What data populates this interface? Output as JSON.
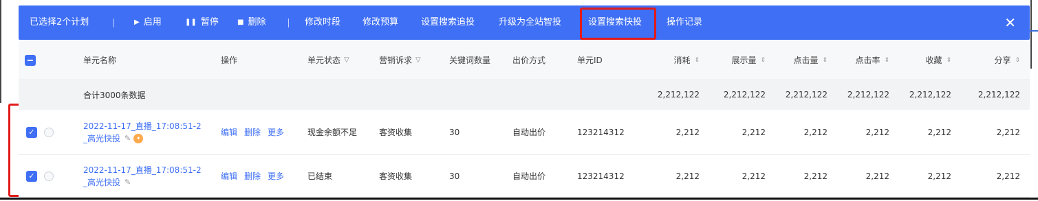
{
  "toolbar": {
    "selected_text": "已选择2个计划",
    "enable_label": "启用",
    "pause_label": "暂停",
    "delete_label": "删除",
    "modify_period": "修改时段",
    "modify_budget": "修改预算",
    "set_search_boost": "设置搜索追投",
    "upgrade_smart": "升级为全站智投",
    "set_search_quick": "设置搜索快投",
    "operation_log": "操作记录",
    "close_glyph": "✕",
    "enable_icon": "play-icon",
    "pause_icon": "pause-icon",
    "delete_icon": "trash-icon"
  },
  "table": {
    "headers": {
      "unit_name": "单元名称",
      "operation": "操作",
      "unit_status": "单元状态",
      "marketing_goal": "营销诉求",
      "keyword_count": "关键词数量",
      "bid_method": "出价方式",
      "unit_id": "单元ID",
      "cost": "消耗",
      "impressions": "展示量",
      "clicks": "点击量",
      "ctr": "点击率",
      "favorites": "收藏",
      "shares": "分享"
    },
    "total": {
      "label": "合计3000条数据",
      "cost": "2,212,122",
      "impressions": "2,212,122",
      "clicks": "2,212,122",
      "ctr": "2,212,122",
      "favorites": "2,212,122",
      "shares": "2,212,122"
    },
    "rows": [
      {
        "name_line1": "2022-11-17_直播_17:08:51-2",
        "name_line2": "_高光快投",
        "op_edit": "编辑",
        "op_delete": "删除",
        "op_more": "更多",
        "status": "现金余额不足",
        "goal": "客资收集",
        "keywords": "30",
        "bid": "自动出价",
        "unit_id": "123214312",
        "cost": "2,212",
        "impressions": "2,212",
        "clicks": "2,212",
        "ctr": "2,212",
        "favorites": "2,212",
        "shares": "2,212"
      },
      {
        "name_line1": "2022-11-17_直播_17:08:51-2",
        "name_line2": "_高光快投",
        "op_edit": "编辑",
        "op_delete": "删除",
        "op_more": "更多",
        "status": "已结束",
        "goal": "客资收集",
        "keywords": "30",
        "bid": "自动出价",
        "unit_id": "123214312",
        "cost": "2,212",
        "impressions": "2,212",
        "clicks": "2,212",
        "ctr": "2,212",
        "favorites": "2,212",
        "shares": "2,212"
      }
    ]
  },
  "colors": {
    "accent": "#3f6ff5",
    "highlight": "#e21a1a",
    "rocket": "#ffa94d"
  }
}
